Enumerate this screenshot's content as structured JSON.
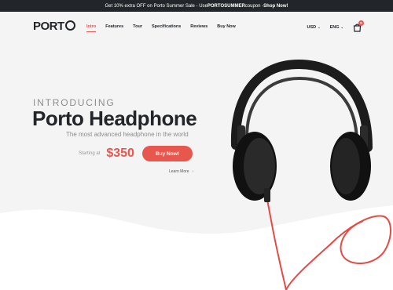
{
  "promo": {
    "text_before": "Get 10% extra OFF on Porto Summer Sale - Use ",
    "coupon": "PORTOSUMMER",
    "text_middle": " coupon - ",
    "cta": "Shop Now!"
  },
  "header": {
    "logo_text": "PORT",
    "nav": [
      {
        "label": "Intro"
      },
      {
        "label": "Features"
      },
      {
        "label": "Tour"
      },
      {
        "label": "Specifications"
      },
      {
        "label": "Reviews"
      },
      {
        "label": "Buy Now"
      }
    ],
    "currency": "USD",
    "language": "ENG",
    "cart_count": "0"
  },
  "hero": {
    "intro": "INTRODUCING",
    "title": "Porto Headphone",
    "subtitle": "The most advanced headphone in the world",
    "price_label": "Starting at",
    "price": "$350",
    "buy_label": "Buy Now!",
    "learn_label": "Learn More"
  },
  "colors": {
    "accent": "#e8574e",
    "dark": "#222529",
    "background": "#f4f4f4"
  },
  "icons": [
    "cart-icon",
    "chevron-down-icon",
    "chevron-right-icon",
    "headphone-image"
  ]
}
